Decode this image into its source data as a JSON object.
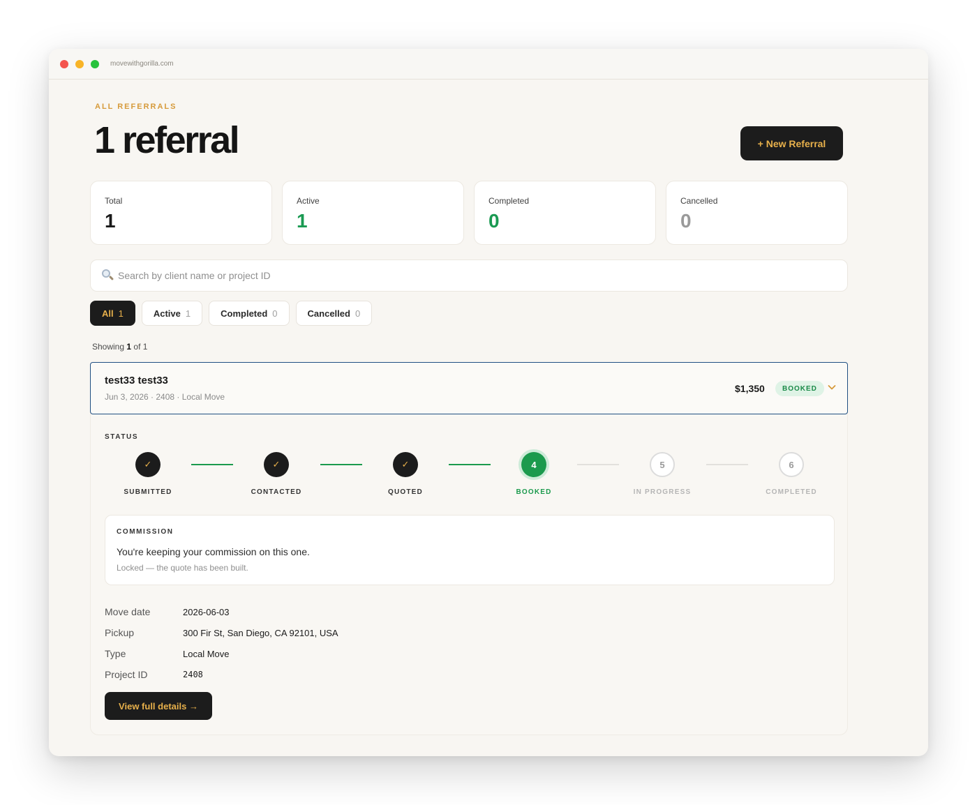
{
  "browser": {
    "url": "movewithgorilla.com"
  },
  "header": {
    "eyebrow": "ALL REFERRALS",
    "title": "1 referral",
    "new_button_label": "+ New Referral"
  },
  "stats": [
    {
      "label": "Total",
      "value": "1"
    },
    {
      "label": "Active",
      "value": "1"
    },
    {
      "label": "Completed",
      "value": "0"
    },
    {
      "label": "Cancelled",
      "value": "0"
    }
  ],
  "search": {
    "placeholder": "Search by client name or project ID",
    "value": ""
  },
  "filters": [
    {
      "label": "All",
      "count": "1",
      "active": true
    },
    {
      "label": "Active",
      "count": "1",
      "active": false
    },
    {
      "label": "Completed",
      "count": "0",
      "active": false
    },
    {
      "label": "Cancelled",
      "count": "0",
      "active": false
    }
  ],
  "showing": {
    "prefix": "Showing",
    "current": "1",
    "middle": "of",
    "total": "1"
  },
  "referral": {
    "client_name": "test33 test33",
    "meta": "Jun 3, 2026 · 2408 · Local Move",
    "amount": "$1,350",
    "badge": "BOOKED",
    "status_label": "STATUS",
    "steps": [
      {
        "marker": "✓",
        "label": "SUBMITTED",
        "state": "done"
      },
      {
        "marker": "✓",
        "label": "CONTACTED",
        "state": "done"
      },
      {
        "marker": "✓",
        "label": "QUOTED",
        "state": "done"
      },
      {
        "marker": "4",
        "label": "BOOKED",
        "state": "current"
      },
      {
        "marker": "5",
        "label": "IN PROGRESS",
        "state": "todo"
      },
      {
        "marker": "6",
        "label": "COMPLETED",
        "state": "todo"
      }
    ],
    "commission": {
      "label": "COMMISSION",
      "message": "You're keeping your commission on this one.",
      "note": "Locked — the quote has been built."
    },
    "details": [
      {
        "key": "Move date",
        "value": "2026-06-03"
      },
      {
        "key": "Pickup",
        "value": "300 Fir St, San Diego, CA 92101, USA"
      },
      {
        "key": "Type",
        "value": "Local Move"
      },
      {
        "key": "Project ID",
        "value": "2408"
      }
    ],
    "view_button_label": "View full details →"
  },
  "colors": {
    "accent_gold": "#e7b04b",
    "success_green": "#1b9a4d",
    "dark": "#1c1c1c",
    "focus_blue": "#1f4f82"
  }
}
